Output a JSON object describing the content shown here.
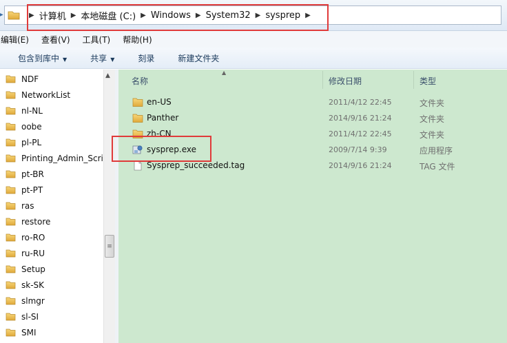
{
  "address": {
    "crumbs": [
      "计算机",
      "本地磁盘 (C:)",
      "Windows",
      "System32",
      "sysprep"
    ]
  },
  "menu": {
    "items": [
      "编辑(E)",
      "查看(V)",
      "工具(T)",
      "帮助(H)"
    ]
  },
  "toolbar": {
    "include_library": "包含到库中",
    "share": "共享",
    "burn": "刻录",
    "new_folder": "新建文件夹"
  },
  "sidebar": {
    "items": [
      "NDF",
      "NetworkList",
      "nl-NL",
      "oobe",
      "pl-PL",
      "Printing_Admin_Scri",
      "pt-BR",
      "pt-PT",
      "ras",
      "restore",
      "ro-RO",
      "ru-RU",
      "Setup",
      "sk-SK",
      "slmgr",
      "sl-SI",
      "SMI"
    ]
  },
  "columns": {
    "name": "名称",
    "modified": "修改日期",
    "type": "类型"
  },
  "files": [
    {
      "name": "en-US",
      "date": "2011/4/12 22:45",
      "type": "文件夹",
      "icon": "folder-icon"
    },
    {
      "name": "Panther",
      "date": "2014/9/16 21:24",
      "type": "文件夹",
      "icon": "folder-icon"
    },
    {
      "name": "zh-CN",
      "date": "2011/4/12 22:45",
      "type": "文件夹",
      "icon": "folder-icon"
    },
    {
      "name": "sysprep.exe",
      "date": "2009/7/14 9:39",
      "type": "应用程序",
      "icon": "application-icon"
    },
    {
      "name": "Sysprep_succeeded.tag",
      "date": "2014/9/16 21:24",
      "type": "TAG 文件",
      "icon": "file-icon"
    }
  ],
  "colors": {
    "content_background": "#cde8cf",
    "highlight_box": "#e03a3a",
    "folder_yellow": "#e8b94a"
  }
}
